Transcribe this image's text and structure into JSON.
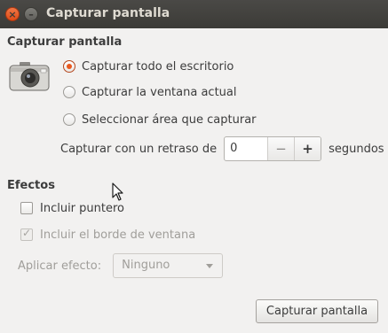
{
  "window": {
    "title": "Capturar pantalla",
    "close_icon": "close-icon",
    "minimize_icon": "minimize-icon"
  },
  "capture": {
    "section_title": "Capturar pantalla",
    "options": [
      {
        "label": "Capturar todo el escritorio",
        "selected": true
      },
      {
        "label": "Capturar la ventana actual",
        "selected": false
      },
      {
        "label": "Seleccionar área que capturar",
        "selected": false
      }
    ],
    "delay_label": "Capturar con un retraso de",
    "delay_value": "0",
    "delay_minus": "−",
    "delay_plus": "+",
    "delay_unit": "segundos"
  },
  "effects": {
    "section_title": "Efectos",
    "include_pointer": {
      "label": "Incluir puntero",
      "checked": false,
      "enabled": true
    },
    "include_border": {
      "label": "Incluir el borde de ventana",
      "checked": true,
      "enabled": false
    },
    "apply_effect_label": "Aplicar efecto:",
    "apply_effect_value": "Ninguno"
  },
  "actions": {
    "capture_button": "Capturar pantalla"
  },
  "colors": {
    "titlebar": "#3c3b37",
    "accent": "#e9591f",
    "window_bg": "#f2f1f0"
  }
}
